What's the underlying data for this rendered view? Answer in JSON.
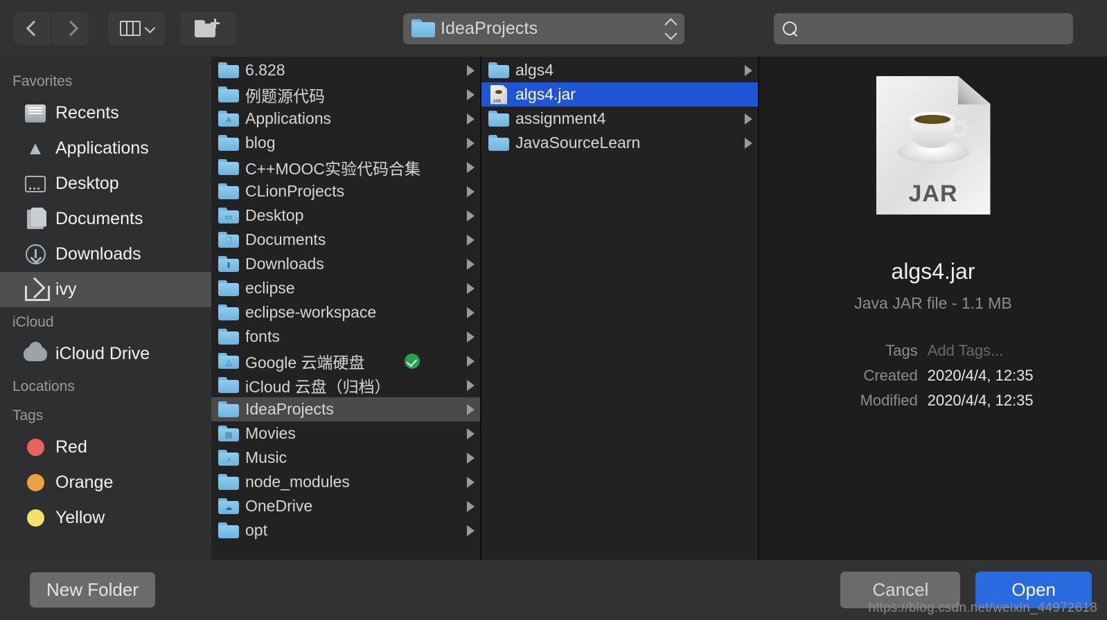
{
  "toolbar": {
    "back_icon": "chevron-left-icon",
    "forward_icon": "chevron-right-icon",
    "view_mode_icon": "column-view-icon",
    "new_folder_icon": "new-folder-icon",
    "path_label": "IdeaProjects",
    "search_value": "",
    "search_placeholder": ""
  },
  "sidebar": {
    "sections": [
      {
        "heading": "Favorites",
        "items": [
          {
            "label": "Recents",
            "icon": "recents-icon",
            "selected": false
          },
          {
            "label": "Applications",
            "icon": "applications-icon",
            "selected": false
          },
          {
            "label": "Desktop",
            "icon": "desktop-icon",
            "selected": false
          },
          {
            "label": "Documents",
            "icon": "documents-icon",
            "selected": false
          },
          {
            "label": "Downloads",
            "icon": "downloads-icon",
            "selected": false
          },
          {
            "label": "ivy",
            "icon": "home-icon",
            "selected": true
          }
        ]
      },
      {
        "heading": "iCloud",
        "items": [
          {
            "label": "iCloud Drive",
            "icon": "cloud-icon",
            "selected": false
          }
        ]
      },
      {
        "heading": "Locations",
        "items": []
      },
      {
        "heading": "Tags",
        "items": [
          {
            "label": "Red",
            "icon": "tag-dot-icon",
            "color": "#e9625c",
            "selected": false
          },
          {
            "label": "Orange",
            "icon": "tag-dot-icon",
            "color": "#eaa33f",
            "selected": false
          },
          {
            "label": "Yellow",
            "icon": "tag-dot-icon",
            "color": "#f7df6b",
            "selected": false
          }
        ]
      }
    ]
  },
  "columns": [
    {
      "name": "column-1",
      "rows": [
        {
          "label": "6.828",
          "type": "folder",
          "glyph": "",
          "arrow": true,
          "selected": false,
          "badge": false
        },
        {
          "label": "例题源代码",
          "type": "folder",
          "glyph": "",
          "arrow": true,
          "selected": false,
          "badge": false
        },
        {
          "label": "Applications",
          "type": "folder",
          "glyph": "A",
          "arrow": true,
          "selected": false,
          "badge": false
        },
        {
          "label": "blog",
          "type": "folder",
          "glyph": "",
          "arrow": true,
          "selected": false,
          "badge": false
        },
        {
          "label": "C++MOOC实验代码合集",
          "type": "folder",
          "glyph": "",
          "arrow": true,
          "selected": false,
          "badge": false
        },
        {
          "label": "CLionProjects",
          "type": "folder",
          "glyph": "",
          "arrow": true,
          "selected": false,
          "badge": false
        },
        {
          "label": "Desktop",
          "type": "folder",
          "glyph": "▭",
          "arrow": true,
          "selected": false,
          "badge": false
        },
        {
          "label": "Documents",
          "type": "folder",
          "glyph": "🗋",
          "arrow": true,
          "selected": false,
          "badge": false
        },
        {
          "label": "Downloads",
          "type": "folder",
          "glyph": "⬇",
          "arrow": true,
          "selected": false,
          "badge": false
        },
        {
          "label": "eclipse",
          "type": "folder",
          "glyph": "",
          "arrow": true,
          "selected": false,
          "badge": false
        },
        {
          "label": "eclipse-workspace",
          "type": "folder",
          "glyph": "",
          "arrow": true,
          "selected": false,
          "badge": false
        },
        {
          "label": "fonts",
          "type": "folder",
          "glyph": "",
          "arrow": true,
          "selected": false,
          "badge": false
        },
        {
          "label": "Google 云端硬盘",
          "type": "folder",
          "glyph": "△",
          "arrow": true,
          "selected": false,
          "badge": true
        },
        {
          "label": "iCloud 云盘（归档）",
          "type": "folder",
          "glyph": "",
          "arrow": true,
          "selected": false,
          "badge": false
        },
        {
          "label": "IdeaProjects",
          "type": "folder",
          "glyph": "",
          "arrow": true,
          "selected": true,
          "badge": false
        },
        {
          "label": "Movies",
          "type": "folder",
          "glyph": "▤",
          "arrow": true,
          "selected": false,
          "badge": false
        },
        {
          "label": "Music",
          "type": "folder",
          "glyph": "♪",
          "arrow": true,
          "selected": false,
          "badge": false
        },
        {
          "label": "node_modules",
          "type": "folder",
          "glyph": "",
          "arrow": true,
          "selected": false,
          "badge": false
        },
        {
          "label": "OneDrive",
          "type": "folder",
          "glyph": "☁",
          "arrow": true,
          "selected": false,
          "badge": false
        },
        {
          "label": "opt",
          "type": "folder",
          "glyph": "",
          "arrow": true,
          "selected": false,
          "badge": false
        }
      ]
    },
    {
      "name": "column-2",
      "rows": [
        {
          "label": "algs4",
          "type": "folder",
          "glyph": "",
          "arrow": true,
          "selected": false,
          "badge": false
        },
        {
          "label": "algs4.jar",
          "type": "jar",
          "glyph": "",
          "arrow": false,
          "selected": true,
          "badge": false
        },
        {
          "label": "assignment4",
          "type": "folder",
          "glyph": "",
          "arrow": true,
          "selected": false,
          "badge": false
        },
        {
          "label": "JavaSourceLearn",
          "type": "folder",
          "glyph": "",
          "arrow": true,
          "selected": false,
          "badge": false
        }
      ]
    }
  ],
  "preview": {
    "icon_label": "JAR",
    "icon_name": "jar-file-icon",
    "title": "algs4.jar",
    "subtitle": "Java JAR file - 1.1 MB",
    "metadata": [
      {
        "key": "Tags",
        "value": "Add Tags...",
        "dim": true
      },
      {
        "key": "Created",
        "value": "2020/4/4, 12:35",
        "dim": false
      },
      {
        "key": "Modified",
        "value": "2020/4/4, 12:35",
        "dim": false
      }
    ]
  },
  "footer": {
    "new_folder_label": "New Folder",
    "cancel_label": "Cancel",
    "open_label": "Open",
    "accent_color": "#2a6ae0"
  },
  "watermark": "https://blog.csdn.net/weixin_44972618"
}
